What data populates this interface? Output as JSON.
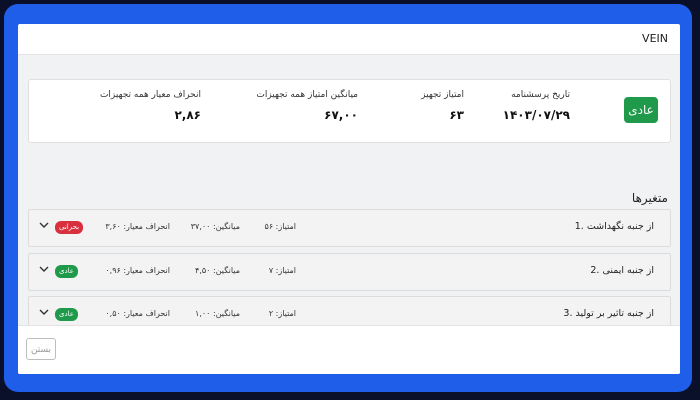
{
  "dialog": {
    "title": "VEIN",
    "status_badge": "عادی",
    "summary": {
      "report_date_label": "تاریخ پرسشنامه",
      "report_date_value": "۱۴۰۳/۰۷/۲۹",
      "equipment_score_label": "امتیاز تجهیز",
      "equipment_score_value": "۶۳",
      "all_avg_label": "میانگین امتیاز همه تجهیزات",
      "all_avg_value": "۶۷,۰۰",
      "std_label": "انحراف معیار همه تجهیزات",
      "std_value": "۲,۸۶"
    },
    "variables_title": "متغیرها",
    "variables": [
      {
        "name": "1. از جنبه نگهداشت",
        "score": "امتیاز: ۵۶",
        "avg": "میانگین: ۳۷,۰۰",
        "std": "انحراف معیار: ۳,۶۰",
        "badge": "بحرانی",
        "badge_color": "#d9303e"
      },
      {
        "name": "2. از جنبه ایمنی",
        "score": "امتیاز: ۷",
        "avg": "میانگین: ۴,۵۰",
        "std": "انحراف معیار: ۰,۹۶",
        "badge": "عادی",
        "badge_color": "#1e9a4a"
      },
      {
        "name": "3. از جنبه تاثیر بر تولید",
        "score": "امتیاز: ۲",
        "avg": "میانگین: ۱,۰۰",
        "std": "انحراف معیار: ۰,۵۰",
        "badge": "عادی",
        "badge_color": "#1e9a4a"
      }
    ],
    "close_button": "بستن"
  }
}
